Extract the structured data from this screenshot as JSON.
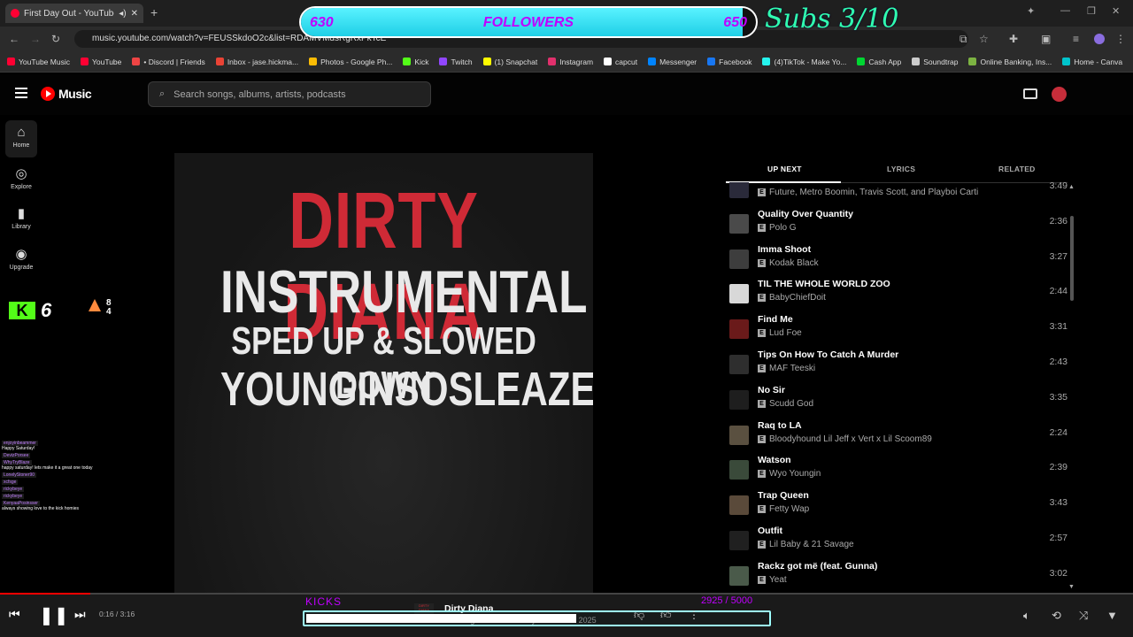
{
  "browser": {
    "tab_title": "First Day Out - YouTube Mu",
    "url": "music.youtube.com/watch?v=FEUSSkdoO2c&list=RDAMVMdsRgRxPkTcE",
    "bookmarks": [
      {
        "label": "YouTube Music",
        "color": "#ff0033"
      },
      {
        "label": "YouTube",
        "color": "#ff0033"
      },
      {
        "label": "• Discord | Friends",
        "color": "#e44"
      },
      {
        "label": "Inbox - jase.hickma...",
        "color": "#ea4335"
      },
      {
        "label": "Photos - Google Ph...",
        "color": "#fbbc04"
      },
      {
        "label": "Kick",
        "color": "#53fc18"
      },
      {
        "label": "Twitch",
        "color": "#9146ff"
      },
      {
        "label": "(1) Snapchat",
        "color": "#fffc00"
      },
      {
        "label": "Instagram",
        "color": "#e1306c"
      },
      {
        "label": "capcut",
        "color": "#ffffff"
      },
      {
        "label": "Messenger",
        "color": "#0084ff"
      },
      {
        "label": "Facebook",
        "color": "#1877f2"
      },
      {
        "label": "(4)TikTok - Make Yo...",
        "color": "#25f4ee"
      },
      {
        "label": "Cash App",
        "color": "#00d632"
      },
      {
        "label": "Soundtrap",
        "color": "#cccccc"
      },
      {
        "label": "Online Banking, Ins...",
        "color": "#7cb342"
      },
      {
        "label": "Home - Canva",
        "color": "#00c4cc"
      }
    ]
  },
  "stream_overlay": {
    "followers_current": "630",
    "followers_label": "FOLLOWERS",
    "followers_goal": "650",
    "followers_fraction": 0.97,
    "subs_text": "Subs 3/10",
    "kick_count": "6",
    "stat_a": "8",
    "stat_b": "4",
    "kicks_label": "KICKS",
    "kicks_value": "2925 / 5000",
    "kicks_fraction": 0.585,
    "chat": [
      {
        "user": "enjoyinbeammer",
        "msg": "Happy Saturday!"
      },
      {
        "user": "DevizPorsee",
        "msg": ""
      },
      {
        "user": "WhyTryBlaze",
        "msg": "happy saturday! lets make it a great one today"
      },
      {
        "user": "LonelyStoner90",
        "msg": ""
      },
      {
        "user": "xcfsge",
        "msg": ""
      },
      {
        "user": "rickybeye",
        "msg": ""
      },
      {
        "user": "rickybeye",
        "msg": ""
      },
      {
        "user": "KenyaaPosinsser",
        "msg": "always showing love to the kick homies"
      }
    ]
  },
  "ytmusic": {
    "logo_text": "Music",
    "search_placeholder": "Search songs, albums, artists, podcasts",
    "sidebar": [
      {
        "label": "Home",
        "icon": "home-icon",
        "glyph": "⌂"
      },
      {
        "label": "Explore",
        "icon": "compass-icon",
        "glyph": "◎"
      },
      {
        "label": "Library",
        "icon": "library-icon",
        "glyph": "▮"
      },
      {
        "label": "Upgrade",
        "icon": "upgrade-icon",
        "glyph": "◉"
      }
    ],
    "cover": {
      "line1": "DIRTY DIANA",
      "line2": "INSTRUMENTAL",
      "line3": "SPED UP & SLOWED DOWN",
      "line4": "YOUNGINSOSLEAZE"
    },
    "tabs": [
      "UP NEXT",
      "LYRICS",
      "RELATED"
    ],
    "queue": [
      {
        "title": "",
        "artist": "Future, Metro Boomin, Travis Scott, and Playboi Carti",
        "duration": "3:49"
      },
      {
        "title": "Quality Over Quantity",
        "artist": "Polo G",
        "duration": "2:36"
      },
      {
        "title": "Imma Shoot",
        "artist": "Kodak Black",
        "duration": "3:27"
      },
      {
        "title": "TIL THE WHOLE WORLD ZOO",
        "artist": "BabyChiefDoit",
        "duration": "2:44"
      },
      {
        "title": "Find Me",
        "artist": "Lud Foe",
        "duration": "3:31"
      },
      {
        "title": "Tips On How To Catch A Murder",
        "artist": "MAF Teeski",
        "duration": "2:43"
      },
      {
        "title": "No Sir",
        "artist": "Scudd God",
        "duration": "3:35"
      },
      {
        "title": "Raq to LA",
        "artist": "Bloodyhound Lil Jeff x Vert x Lil Scoom89",
        "duration": "2:24"
      },
      {
        "title": "Watson",
        "artist": "Wyo Youngin",
        "duration": "2:39"
      },
      {
        "title": "Trap Queen",
        "artist": "Fetty Wap",
        "duration": "3:43"
      },
      {
        "title": "Outfit",
        "artist": "Lil Baby & 21 Savage",
        "duration": "2:57"
      },
      {
        "title": "Rackz got më (feat. Gunna)",
        "artist": "Yeat",
        "duration": "3:02"
      }
    ],
    "player": {
      "time": "0:16 / 3:16",
      "progress_fraction": 0.08,
      "now_title": "Dirty Diana",
      "now_sub": "Youginsosleaze · Dirty Diana EP · 2025"
    }
  }
}
